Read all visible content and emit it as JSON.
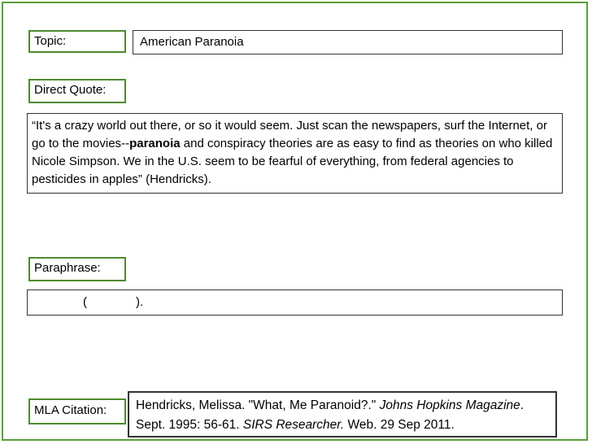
{
  "topic": {
    "label": "Topic:",
    "value": "American Paranoia"
  },
  "direct_quote": {
    "label": "Direct Quote:",
    "text_before": "“It's a crazy world out there, or so it would seem. Just scan the newspapers, surf the Internet, or go to the movies--",
    "text_bold": "paranoia",
    "text_after": " and conspiracy theories are as easy to find as theories on who killed Nicole Simpson. We in the U.S. seem to be fearful of everything, from federal agencies to pesticides in apples” (Hendricks)."
  },
  "paraphrase": {
    "label": "Paraphrase:",
    "open_paren": "(",
    "close_paren": ")."
  },
  "mla_citation": {
    "label": "MLA Citation:",
    "part1": "Hendricks, Melissa. \"What, Me Paranoid?.\" ",
    "italic1": "Johns Hopkins Magazine",
    "part2": ". Sept. 1995: 56-61. ",
    "italic2": "SIRS Researcher.",
    "part3": " Web. 29 Sep 2011."
  },
  "colors": {
    "frame": "#5a9e3a",
    "label_border": "#4e8a2e",
    "box_border": "#333333"
  }
}
